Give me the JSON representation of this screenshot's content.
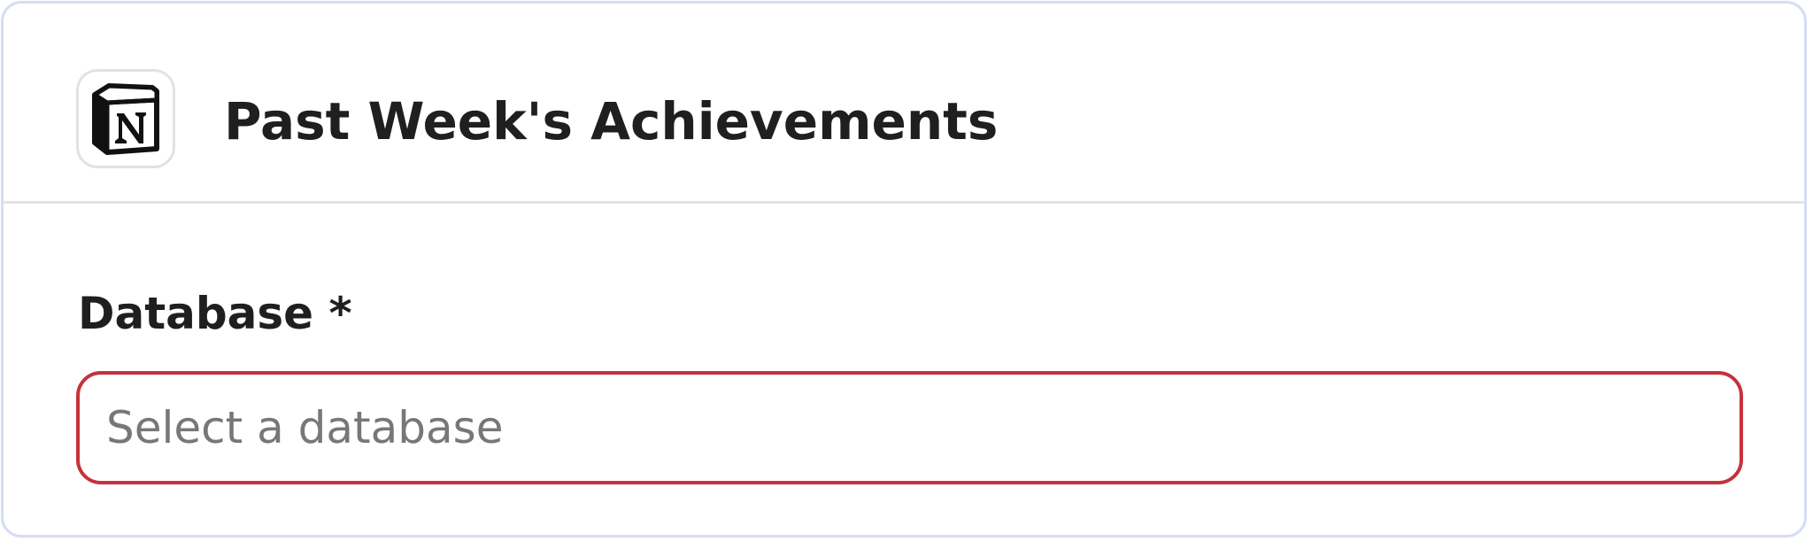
{
  "header": {
    "icon": "notion-logo-icon",
    "title": "Past Week's Achievements"
  },
  "form": {
    "database": {
      "label": "Database *",
      "placeholder": "Select a database",
      "value": ""
    }
  },
  "colors": {
    "card_border": "#d6dcf8",
    "divider": "#e3e3e3",
    "error_border": "#c5323c",
    "placeholder_text": "#777777",
    "heading_text": "#1f1f1f"
  }
}
